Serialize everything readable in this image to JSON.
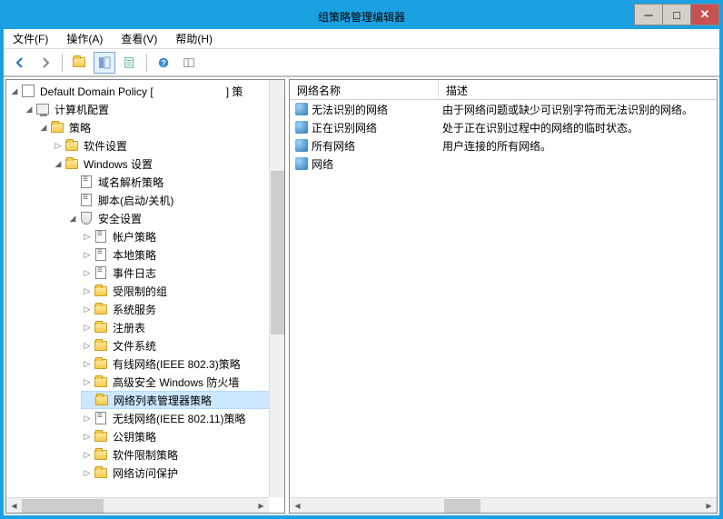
{
  "window": {
    "title": "组策略管理编辑器"
  },
  "menu": {
    "file": "文件(F)",
    "action": "操作(A)",
    "view": "查看(V)",
    "help": "帮助(H)"
  },
  "tree": {
    "root": "Default Domain Policy [",
    "root_suffix": "] 策",
    "computer_config": "计算机配置",
    "policy": "策略",
    "software_settings": "软件设置",
    "windows_settings": "Windows 设置",
    "dns_policy": "域名解析策略",
    "scripts": "脚本(启动/关机)",
    "security_settings": "安全设置",
    "account_policy": "帐户策略",
    "local_policy": "本地策略",
    "event_log": "事件日志",
    "restricted_groups": "受限制的组",
    "system_services": "系统服务",
    "registry": "注册表",
    "file_system": "文件系统",
    "wired_network": "有线网络(IEEE 802.3)策略",
    "windows_firewall": "高级安全 Windows 防火墙",
    "network_list_manager": "网络列表管理器策略",
    "wireless_network": "无线网络(IEEE 802.11)策略",
    "public_key": "公钥策略",
    "software_restriction": "软件限制策略",
    "network_access_protection": "网络访问保护"
  },
  "list": {
    "col_name": "网络名称",
    "col_desc": "描述",
    "rows": [
      {
        "name": "无法识别的网络",
        "desc": "由于网络问题或缺少可识别字符而无法识别的网络。"
      },
      {
        "name": "正在识别网络",
        "desc": "处于正在识别过程中的网络的临时状态。"
      },
      {
        "name": "所有网络",
        "desc": "用户连接的所有网络。"
      },
      {
        "name": "网络",
        "desc": ""
      }
    ]
  }
}
